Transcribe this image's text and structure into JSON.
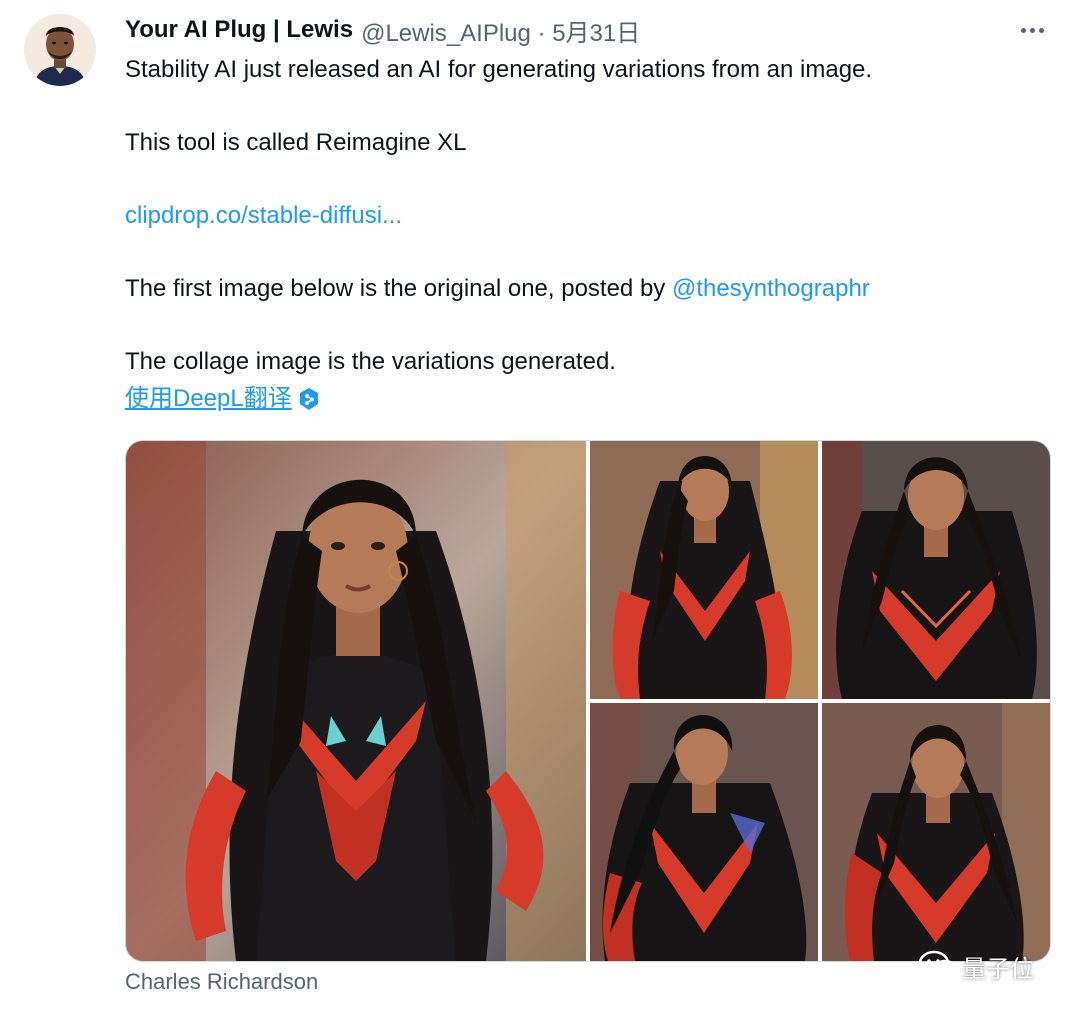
{
  "tweet": {
    "author_name": "Your AI Plug | Lewis",
    "author_handle": "@Lewis_AIPlug · 5月31日",
    "line1": "Stability AI just released an AI for generating variations from an image.",
    "line2": "This tool is called Reimagine XL",
    "link_text": "clipdrop.co/stable-diffusi...",
    "line3_prefix": "The first image below is the original one, posted by ",
    "mention": "@thesynthographr",
    "line4": "The collage image is the variations generated.",
    "translate_label": "使用DeepL翻译",
    "caption": "Charles Richardson"
  },
  "watermark": {
    "text": "量子位"
  },
  "icons": {
    "more": "more-icon",
    "deepl": "deepl-icon",
    "wechat": "wechat-icon"
  },
  "colors": {
    "link": "#1d9bf0",
    "secondary": "#536471",
    "suit_red": "#d63a2a",
    "suit_black": "#1c1a1d"
  }
}
